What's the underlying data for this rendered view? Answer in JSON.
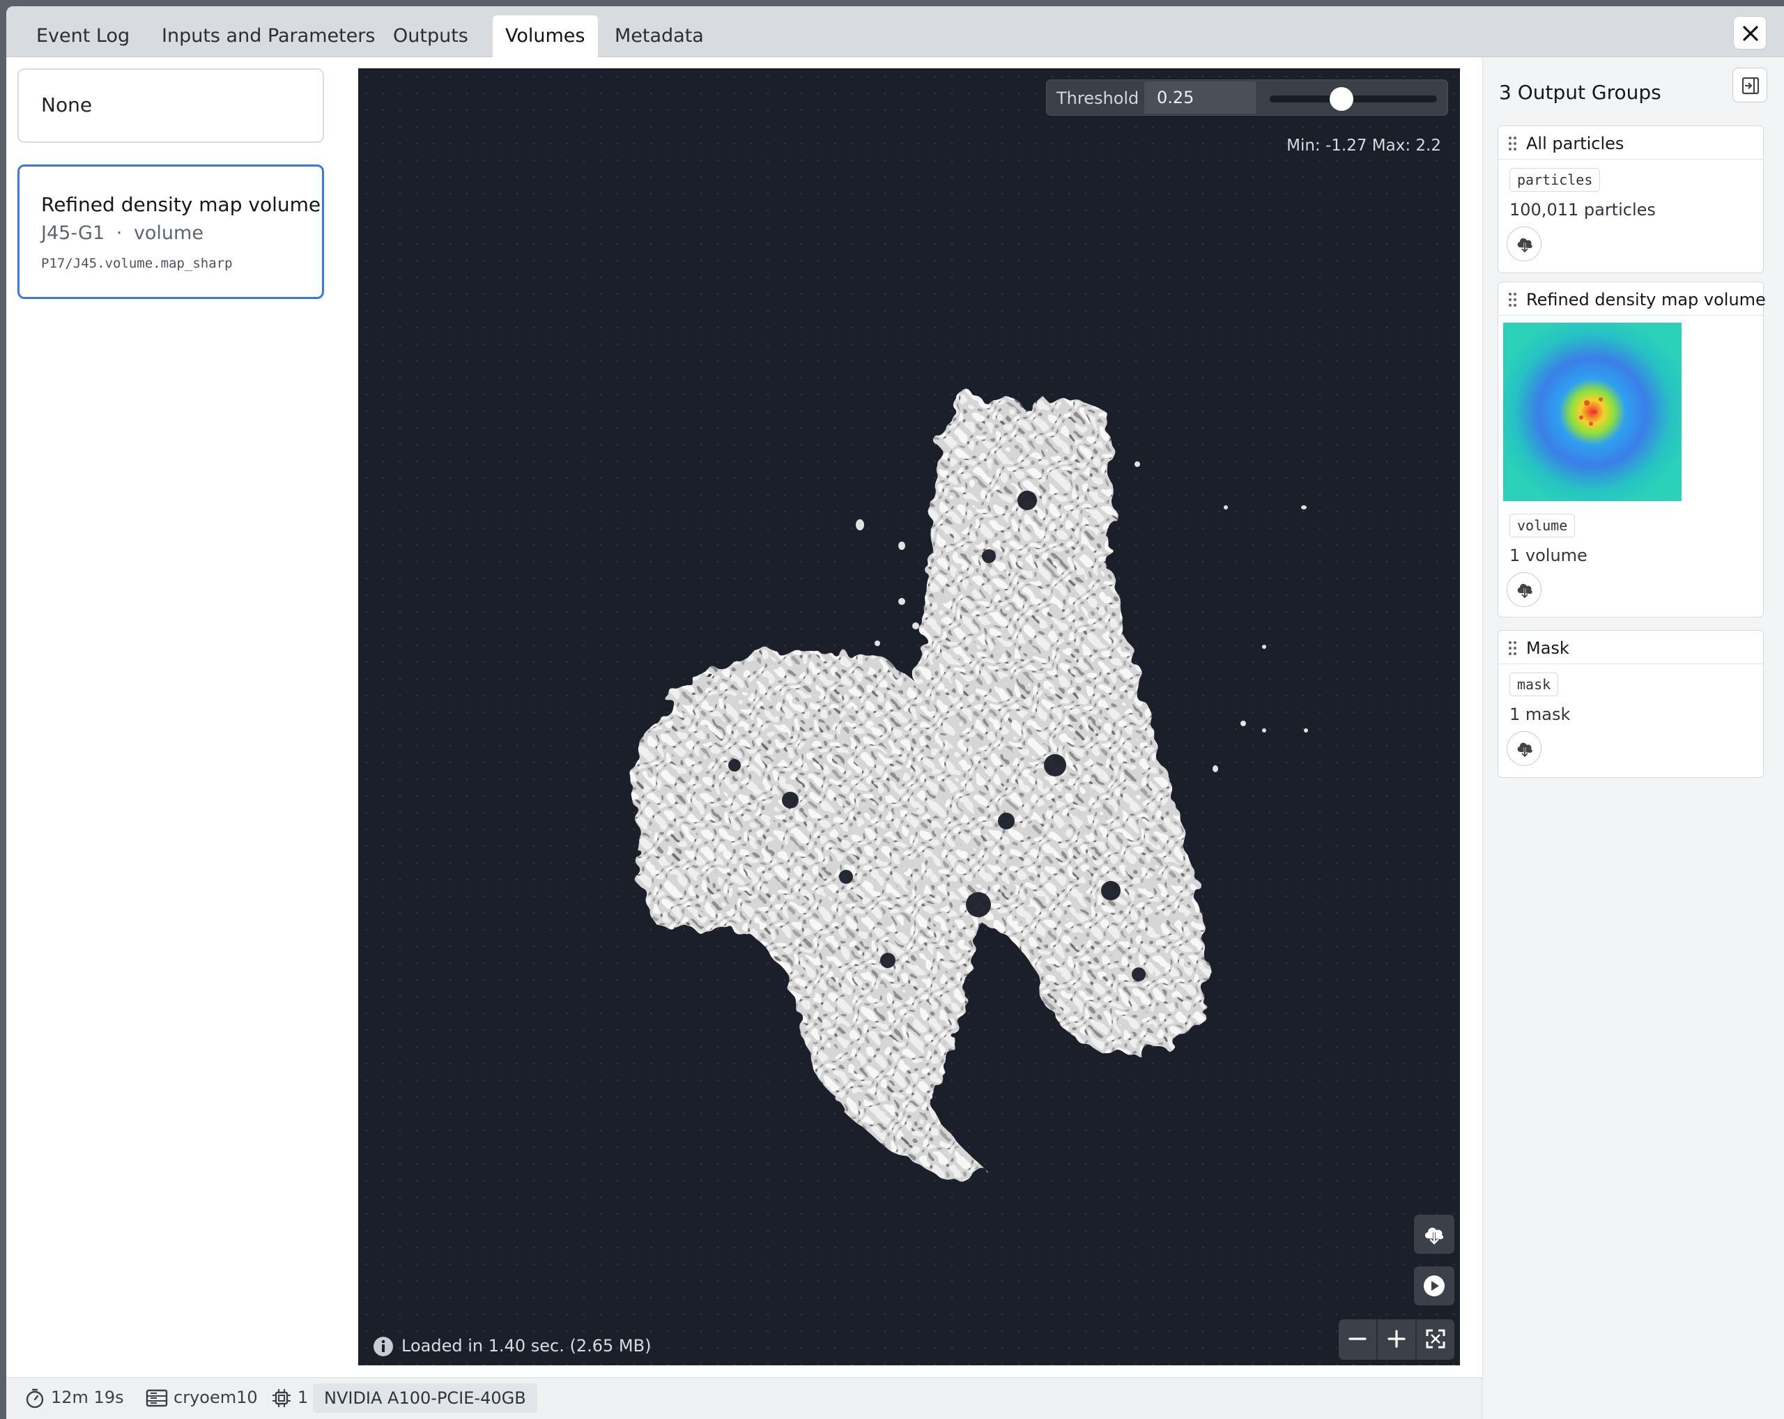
{
  "tabs": [
    {
      "label": "Event Log"
    },
    {
      "label": "Inputs and Parameters"
    },
    {
      "label": "Outputs"
    },
    {
      "label": "Volumes"
    },
    {
      "label": "Metadata"
    }
  ],
  "active_tab": "Volumes",
  "volume_list": {
    "none_label": "None",
    "selected": {
      "title": "Refined density map volume",
      "job_group": "J45-G1",
      "separator": "·",
      "kind": "volume",
      "path": "P17/J45.volume.map_sharp"
    }
  },
  "viewer": {
    "threshold_label": "Threshold",
    "threshold_value": "0.25",
    "threshold_fraction": 0.43,
    "min_max": "Min: -1.27  Max: 2.2",
    "load_info": "Loaded in 1.40 sec. (2.65 MB)"
  },
  "output_groups": {
    "title": "3 Output Groups",
    "groups": [
      {
        "name": "All particles",
        "tag": "particles",
        "count": "100,011 particles"
      },
      {
        "name": "Refined density map volume",
        "tag": "volume",
        "count": "1 volume"
      },
      {
        "name": "Mask",
        "tag": "mask",
        "count": "1 mask"
      }
    ]
  },
  "status": {
    "elapsed": "12m 19s",
    "host": "cryoem10",
    "gpu_count": "1",
    "gpu_name": "NVIDIA A100-PCIE-40GB"
  },
  "colors": {
    "accent": "#3b78e7",
    "viewer_bg": "#1b1f29",
    "density": "#e8e8e8"
  },
  "icons": {
    "close": "close-icon",
    "dock": "dock-icon",
    "download": "cloud-download-icon",
    "play": "play-icon",
    "zoom_out": "minus-icon",
    "zoom_in": "plus-icon",
    "fullscreen": "fullscreen-icon",
    "info": "info-icon",
    "timer": "stopwatch-icon",
    "server": "server-icon",
    "chip": "chip-icon",
    "grip": "drag-grip-icon"
  }
}
